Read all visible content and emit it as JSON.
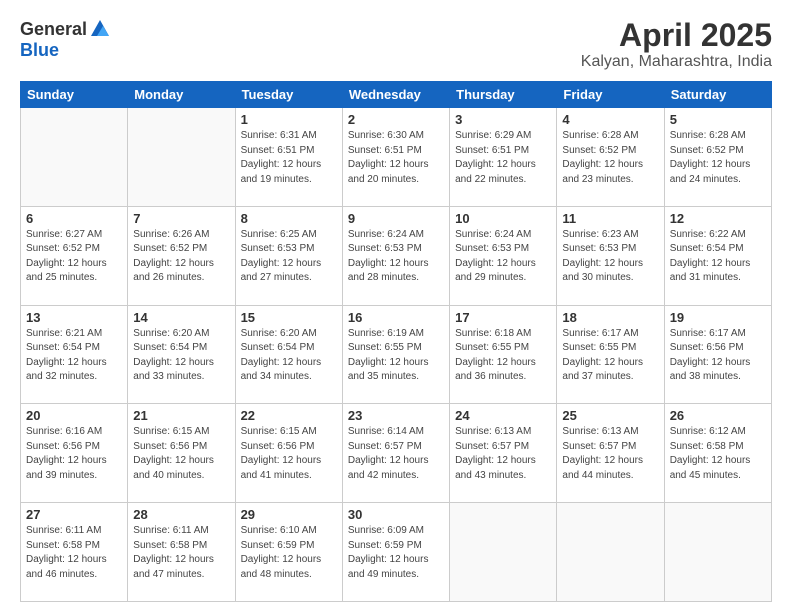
{
  "logo": {
    "general": "General",
    "blue": "Blue"
  },
  "header": {
    "title": "April 2025",
    "subtitle": "Kalyan, Maharashtra, India"
  },
  "weekdays": [
    "Sunday",
    "Monday",
    "Tuesday",
    "Wednesday",
    "Thursday",
    "Friday",
    "Saturday"
  ],
  "weeks": [
    [
      {
        "day": "",
        "info": ""
      },
      {
        "day": "",
        "info": ""
      },
      {
        "day": "1",
        "info": "Sunrise: 6:31 AM\nSunset: 6:51 PM\nDaylight: 12 hours and 19 minutes."
      },
      {
        "day": "2",
        "info": "Sunrise: 6:30 AM\nSunset: 6:51 PM\nDaylight: 12 hours and 20 minutes."
      },
      {
        "day": "3",
        "info": "Sunrise: 6:29 AM\nSunset: 6:51 PM\nDaylight: 12 hours and 22 minutes."
      },
      {
        "day": "4",
        "info": "Sunrise: 6:28 AM\nSunset: 6:52 PM\nDaylight: 12 hours and 23 minutes."
      },
      {
        "day": "5",
        "info": "Sunrise: 6:28 AM\nSunset: 6:52 PM\nDaylight: 12 hours and 24 minutes."
      }
    ],
    [
      {
        "day": "6",
        "info": "Sunrise: 6:27 AM\nSunset: 6:52 PM\nDaylight: 12 hours and 25 minutes."
      },
      {
        "day": "7",
        "info": "Sunrise: 6:26 AM\nSunset: 6:52 PM\nDaylight: 12 hours and 26 minutes."
      },
      {
        "day": "8",
        "info": "Sunrise: 6:25 AM\nSunset: 6:53 PM\nDaylight: 12 hours and 27 minutes."
      },
      {
        "day": "9",
        "info": "Sunrise: 6:24 AM\nSunset: 6:53 PM\nDaylight: 12 hours and 28 minutes."
      },
      {
        "day": "10",
        "info": "Sunrise: 6:24 AM\nSunset: 6:53 PM\nDaylight: 12 hours and 29 minutes."
      },
      {
        "day": "11",
        "info": "Sunrise: 6:23 AM\nSunset: 6:53 PM\nDaylight: 12 hours and 30 minutes."
      },
      {
        "day": "12",
        "info": "Sunrise: 6:22 AM\nSunset: 6:54 PM\nDaylight: 12 hours and 31 minutes."
      }
    ],
    [
      {
        "day": "13",
        "info": "Sunrise: 6:21 AM\nSunset: 6:54 PM\nDaylight: 12 hours and 32 minutes."
      },
      {
        "day": "14",
        "info": "Sunrise: 6:20 AM\nSunset: 6:54 PM\nDaylight: 12 hours and 33 minutes."
      },
      {
        "day": "15",
        "info": "Sunrise: 6:20 AM\nSunset: 6:54 PM\nDaylight: 12 hours and 34 minutes."
      },
      {
        "day": "16",
        "info": "Sunrise: 6:19 AM\nSunset: 6:55 PM\nDaylight: 12 hours and 35 minutes."
      },
      {
        "day": "17",
        "info": "Sunrise: 6:18 AM\nSunset: 6:55 PM\nDaylight: 12 hours and 36 minutes."
      },
      {
        "day": "18",
        "info": "Sunrise: 6:17 AM\nSunset: 6:55 PM\nDaylight: 12 hours and 37 minutes."
      },
      {
        "day": "19",
        "info": "Sunrise: 6:17 AM\nSunset: 6:56 PM\nDaylight: 12 hours and 38 minutes."
      }
    ],
    [
      {
        "day": "20",
        "info": "Sunrise: 6:16 AM\nSunset: 6:56 PM\nDaylight: 12 hours and 39 minutes."
      },
      {
        "day": "21",
        "info": "Sunrise: 6:15 AM\nSunset: 6:56 PM\nDaylight: 12 hours and 40 minutes."
      },
      {
        "day": "22",
        "info": "Sunrise: 6:15 AM\nSunset: 6:56 PM\nDaylight: 12 hours and 41 minutes."
      },
      {
        "day": "23",
        "info": "Sunrise: 6:14 AM\nSunset: 6:57 PM\nDaylight: 12 hours and 42 minutes."
      },
      {
        "day": "24",
        "info": "Sunrise: 6:13 AM\nSunset: 6:57 PM\nDaylight: 12 hours and 43 minutes."
      },
      {
        "day": "25",
        "info": "Sunrise: 6:13 AM\nSunset: 6:57 PM\nDaylight: 12 hours and 44 minutes."
      },
      {
        "day": "26",
        "info": "Sunrise: 6:12 AM\nSunset: 6:58 PM\nDaylight: 12 hours and 45 minutes."
      }
    ],
    [
      {
        "day": "27",
        "info": "Sunrise: 6:11 AM\nSunset: 6:58 PM\nDaylight: 12 hours and 46 minutes."
      },
      {
        "day": "28",
        "info": "Sunrise: 6:11 AM\nSunset: 6:58 PM\nDaylight: 12 hours and 47 minutes."
      },
      {
        "day": "29",
        "info": "Sunrise: 6:10 AM\nSunset: 6:59 PM\nDaylight: 12 hours and 48 minutes."
      },
      {
        "day": "30",
        "info": "Sunrise: 6:09 AM\nSunset: 6:59 PM\nDaylight: 12 hours and 49 minutes."
      },
      {
        "day": "",
        "info": ""
      },
      {
        "day": "",
        "info": ""
      },
      {
        "day": "",
        "info": ""
      }
    ]
  ]
}
